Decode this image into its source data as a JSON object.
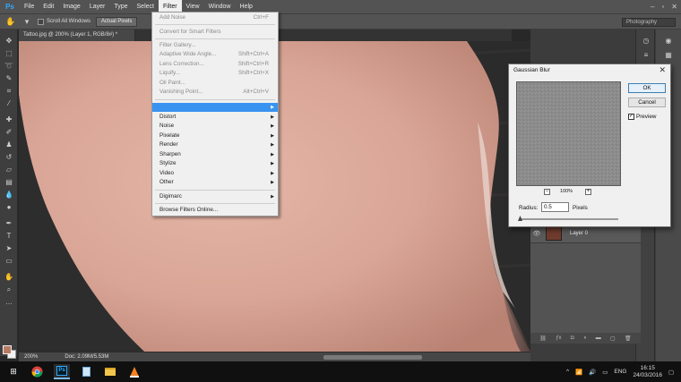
{
  "app": {
    "logo": "Ps",
    "menus": [
      "File",
      "Edit",
      "Image",
      "Layer",
      "Type",
      "Select",
      "Filter",
      "View",
      "Window",
      "Help"
    ],
    "active_menu": "Filter"
  },
  "options_bar": {
    "scroll_all_windows": "Scroll All Windows",
    "actual_pixels": "Actual Pixels",
    "workspace": "Photography"
  },
  "document": {
    "tab_title": "Tattoo.jpg @ 200% (Layer 1, RGB/8#) *",
    "status_zoom": "200%",
    "status_doc": "Doc: 2.09M/5.53M"
  },
  "filter_menu": {
    "items": [
      {
        "label": "Add Noise",
        "shortcut": "Ctrl+F",
        "disabled": true
      },
      {
        "label": "Convert for Smart Filters",
        "shortcut": "",
        "disabled": true
      },
      {
        "label": "Filter Gallery...",
        "shortcut": "",
        "disabled": true
      },
      {
        "label": "Adaptive Wide Angle...",
        "shortcut": "Shift+Ctrl+A",
        "disabled": true
      },
      {
        "label": "Lens Correction...",
        "shortcut": "Shift+Ctrl+R",
        "disabled": true
      },
      {
        "label": "Liquify...",
        "shortcut": "Shift+Ctrl+X",
        "disabled": true
      },
      {
        "label": "Oil Paint...",
        "shortcut": "",
        "disabled": true
      },
      {
        "label": "Vanishing Point...",
        "shortcut": "Alt+Ctrl+V",
        "disabled": true
      },
      {
        "label": "Blur",
        "submenu": true,
        "highlighted": true
      },
      {
        "label": "Distort",
        "submenu": true
      },
      {
        "label": "Noise",
        "submenu": true
      },
      {
        "label": "Pixelate",
        "submenu": true
      },
      {
        "label": "Render",
        "submenu": true
      },
      {
        "label": "Sharpen",
        "submenu": true
      },
      {
        "label": "Stylize",
        "submenu": true
      },
      {
        "label": "Video",
        "submenu": true
      },
      {
        "label": "Other",
        "submenu": true
      },
      {
        "label": "Digimarc",
        "submenu": true
      },
      {
        "label": "Browse Filters Online...",
        "shortcut": ""
      }
    ]
  },
  "dialog": {
    "title": "Gaussian Blur",
    "ok": "OK",
    "cancel": "Cancel",
    "preview_label": "Preview",
    "preview_checked": true,
    "zoom": "100%",
    "radius_label": "Radius:",
    "radius_value": "0.5",
    "radius_unit": "Pixels",
    "radius_slider_fraction": 0.0
  },
  "layers": {
    "layer_name": "Layer 0"
  },
  "taskbar": {
    "language": "ENG",
    "time": "16:15",
    "date": "24/03/2016"
  },
  "colors": {
    "skin": "#d9a89a",
    "accent": "#3993f0",
    "foreground_swatch": "#b97a63"
  }
}
